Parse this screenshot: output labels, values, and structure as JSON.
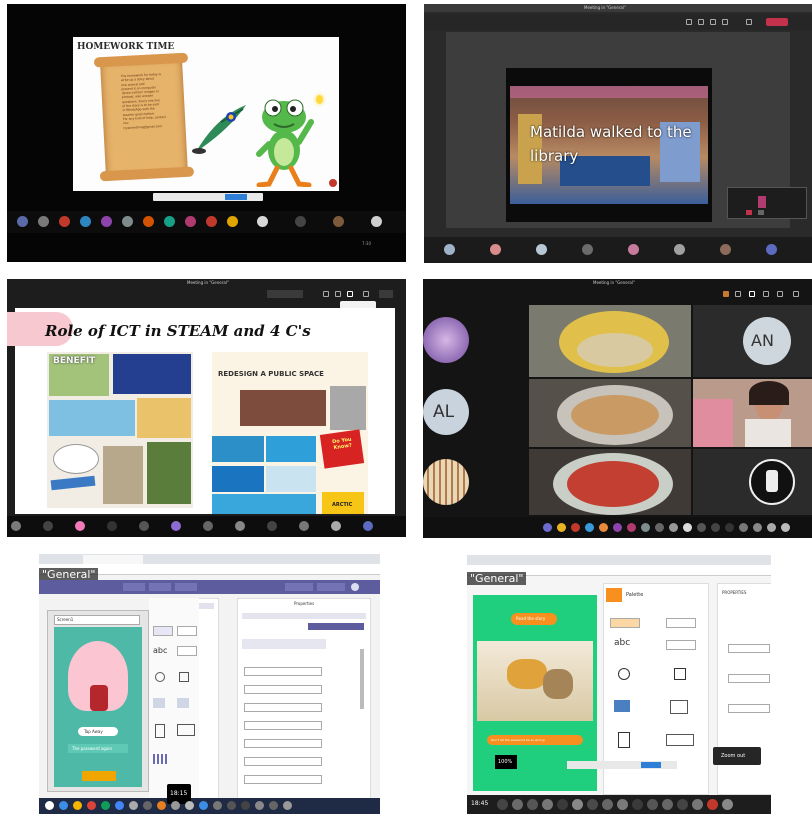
{
  "p1": {
    "slide_title": "HOMEWORK TIME",
    "scroll_lines": [
      "The homework for today is",
      "write up a story about",
      "one animal and",
      "present it on computer",
      "(Draw cartoon images or",
      "photos); also answer",
      "questions. Every one line",
      "of the story is to be said",
      "in WhatsApp with the",
      "teacher given before.",
      "For any kind of help, contact",
      "me:",
      "trysomething@gmail.com"
    ],
    "clock": "7:30"
  },
  "p2": {
    "window_title": "Meeting in \"General\"",
    "caption": "Matilda walked to the library"
  },
  "p3": {
    "window_title": "Meeting in \"General\"",
    "slide_title": "Role of ICT in  STEAM and 4 C's",
    "benefit": "BENEFIT",
    "redesign": "REDESIGN A PUBLIC SPACE",
    "do_you_know": "Do You Know?",
    "arctic": "ARCTIC"
  },
  "p4": {
    "window_title": "Meeting in \"General\"",
    "initials_an": "AN",
    "initials_al": "AL"
  },
  "p5": {
    "general": "\"General\"",
    "dropdown": "Screen1",
    "props_title": "Properties",
    "btn1": "Tap Away",
    "btn2": "The password again",
    "clock": "18:15"
  },
  "p6": {
    "general": "\"General\"",
    "btn_top": "Read the story",
    "btn_bottom": "Don't let the password be so strong",
    "zoom": "100%",
    "palette": "Palette",
    "props": "PROPERTIES",
    "zoom_btn": "Zoom out",
    "clock": "18:45"
  },
  "colors": {
    "black": "#0a0a0a",
    "teams_dark": "#1f1f1f",
    "appinventor_purple": "#5c5c9e",
    "green": "#53a34a",
    "pink": "#d94c79"
  }
}
